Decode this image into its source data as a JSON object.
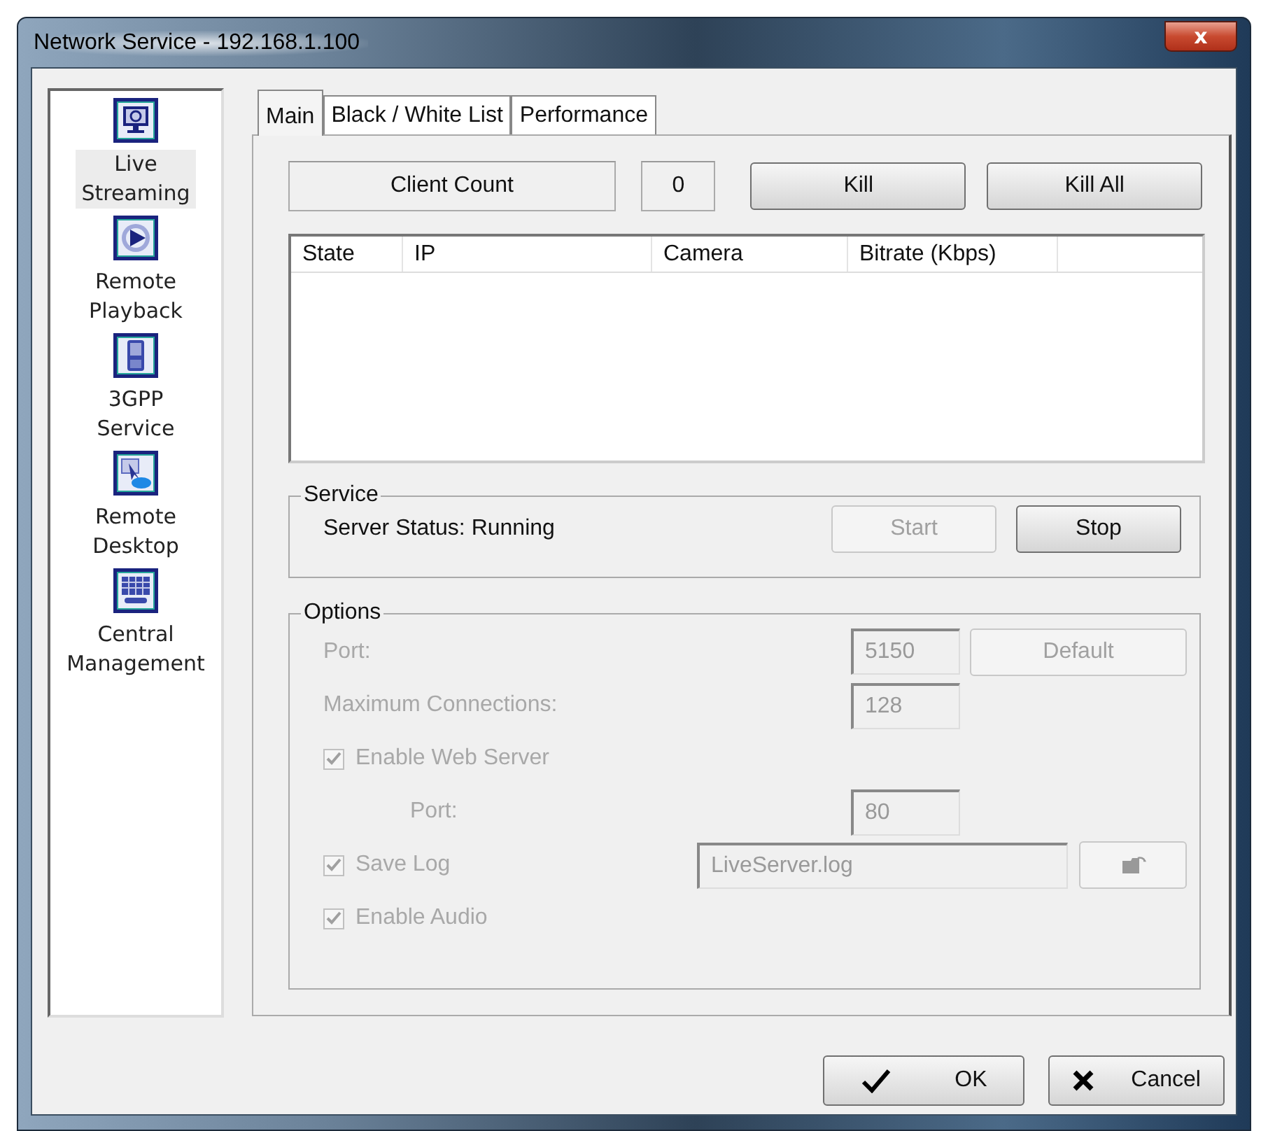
{
  "window": {
    "title": "Network Service - 192.168.1.100",
    "close": "x"
  },
  "sidebar": {
    "items": [
      {
        "kind": "live",
        "label": "Live Streaming",
        "selected": true
      },
      {
        "kind": "playback",
        "label": "Remote Playback",
        "selected": false
      },
      {
        "kind": "phone",
        "label": "3GPP Service",
        "selected": false
      },
      {
        "kind": "desktop",
        "label": "Remote Desktop",
        "selected": false
      },
      {
        "kind": "grid",
        "label": "Central Management",
        "selected": false
      }
    ]
  },
  "tabs": [
    {
      "label": "Main",
      "selected": true
    },
    {
      "label": "Black / White List",
      "selected": false
    },
    {
      "label": "Performance",
      "selected": false
    }
  ],
  "client_bar": {
    "label": "Client Count",
    "count": "0",
    "buttons": [
      {
        "label": "Kill",
        "disabled": false
      },
      {
        "label": "Kill All",
        "disabled": false
      }
    ]
  },
  "table": {
    "columns": [
      "State",
      "IP",
      "Camera",
      "Bitrate (Kbps)"
    ]
  },
  "service": {
    "title": "Service",
    "status": "Server Status: Running",
    "buttons": [
      {
        "label": "Start",
        "disabled": true
      },
      {
        "label": "Stop",
        "disabled": false
      }
    ]
  },
  "options": {
    "title": "Options",
    "rows": [
      {
        "kind": "field",
        "label": "Port:",
        "value": "5150",
        "button": "Default",
        "disabled": true
      },
      {
        "kind": "field",
        "label": "Maximum Connections:",
        "value": "128",
        "disabled": true
      },
      {
        "kind": "checkbox",
        "label": "Enable Web Server",
        "checked": true,
        "disabled": true,
        "children": [
          {
            "kind": "field",
            "label": "Port:",
            "value": "80",
            "disabled": true
          }
        ]
      },
      {
        "kind": "file",
        "label": "Save Log",
        "checked": true,
        "value": "LiveServer.log",
        "disabled": true
      },
      {
        "kind": "checkbox",
        "label": "Enable Audio",
        "checked": true,
        "disabled": true
      }
    ]
  },
  "footer": {
    "buttons": [
      {
        "kind": "ok",
        "label": "OK"
      },
      {
        "kind": "cancel",
        "label": "Cancel"
      }
    ]
  }
}
